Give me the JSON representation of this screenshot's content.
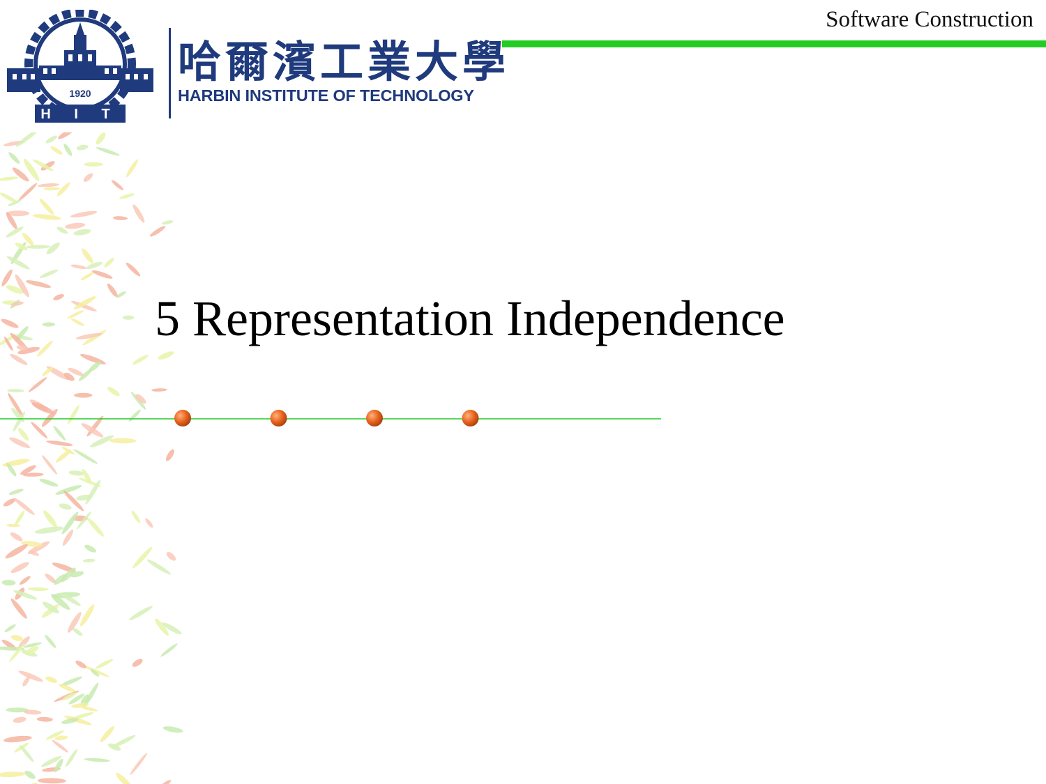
{
  "header": {
    "course_label": "Software Construction",
    "accent_color": "#22cc22"
  },
  "logo": {
    "emblem_icon": "hit-gear-emblem-icon",
    "emblem_year": "1920",
    "emblem_letters": "H I T",
    "name_cn": "哈爾濱工業大學",
    "name_en": "HARBIN INSTITUTE OF TECHNOLOGY",
    "color": "#1f3a7d"
  },
  "slide": {
    "title": "5 Representation Independence"
  },
  "divider": {
    "line_color": "#22cc22",
    "dot_color": "#e8631f",
    "dot_count": 4
  },
  "decoration": {
    "pattern_icon": "leaf-pattern-icon"
  }
}
